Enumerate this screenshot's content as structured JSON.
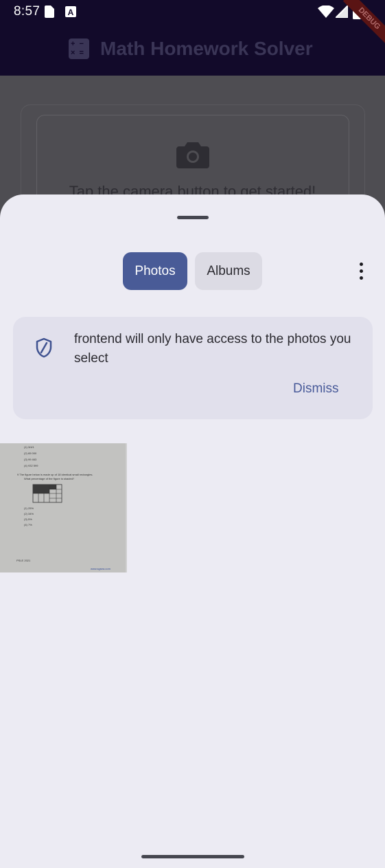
{
  "status_bar": {
    "time": "8:57",
    "icons": [
      "sim-card-icon",
      "a-box-icon",
      "wifi-icon",
      "cellular-signal-icon",
      "battery-icon"
    ]
  },
  "app": {
    "title": "Math Homework Solver",
    "title_icon": "calculator-icon",
    "debug_banner": "DEBUG",
    "hint": "Tap the camera button to get started!",
    "camera_icon": "camera-icon"
  },
  "picker": {
    "tabs": [
      {
        "label": "Photos",
        "selected": true
      },
      {
        "label": "Albums",
        "selected": false
      }
    ],
    "more_icon": "more-vert-icon",
    "banner": {
      "icon": "shield-icon",
      "text": "frontend will only have access to the photos you select",
      "dismiss_label": "Dismiss"
    },
    "thumbnail": {
      "lines": [
        "(1)  3/4/1",
        "(2)  65 000",
        "(3)  99 463",
        "(4)  932 599",
        "9   The figure below is made up of 18 identical small rectangles.",
        "What percentage of the figure is shaded?",
        "(1)  25%",
        "(2)  34%",
        "(3)  5%",
        "(4)  7%",
        "PSLE 2021",
        "www.sgsea.com"
      ]
    },
    "colors": {
      "accent": "#495b97",
      "sheet_bg": "#ecebf3",
      "banner_bg": "#e1e0ec"
    }
  }
}
